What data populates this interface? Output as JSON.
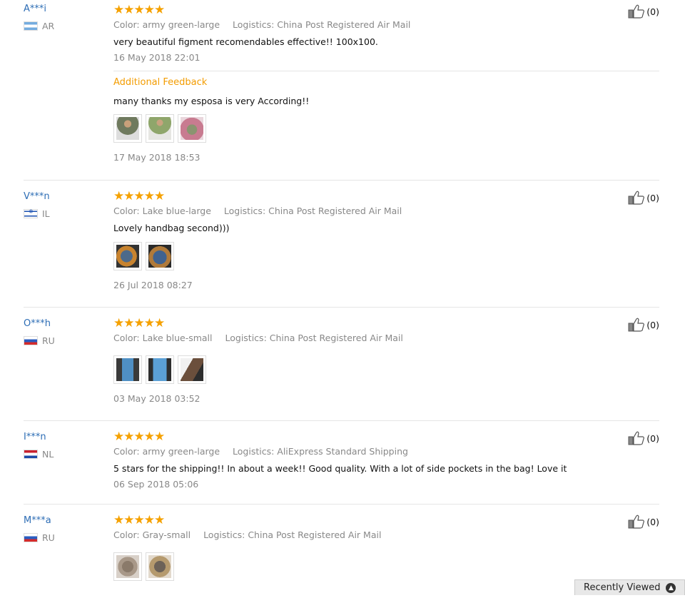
{
  "reviews": [
    {
      "user": "A***i",
      "country": "AR",
      "stars": "★★★★★",
      "color": "Color: army green-large",
      "logistics": "Logistics: China Post Registered Air Mail",
      "text": "very beautiful figment recomendables effective!! 100x100.",
      "date": "16 May 2018 22:01",
      "likes": "(0)",
      "additional": {
        "title": "Additional Feedback",
        "text": "many thanks my esposa is very According!!",
        "date": "17 May 2018 18:53"
      }
    },
    {
      "user": "V***n",
      "country": "IL",
      "stars": "★★★★★",
      "color": "Color: Lake blue-large",
      "logistics": "Logistics: China Post Registered Air Mail",
      "text": "Lovely handbag second)))",
      "date": "26 Jul 2018 08:27",
      "likes": "(0)"
    },
    {
      "user": "O***h",
      "country": "RU",
      "stars": "★★★★★",
      "color": "Color: Lake blue-small",
      "logistics": "Logistics: China Post Registered Air Mail",
      "date": "03 May 2018 03:52",
      "likes": "(0)"
    },
    {
      "user": "I***n",
      "country": "NL",
      "stars": "★★★★★",
      "color": "Color: army green-large",
      "logistics": "Logistics: AliExpress Standard Shipping",
      "text": "5 stars for the shipping!! In about a week!! Good quality. With a lot of side pockets in the bag! Love it",
      "date": "06 Sep 2018 05:06",
      "likes": "(0)"
    },
    {
      "user": "M***a",
      "country": "RU",
      "stars": "★★★★★",
      "color": "Color: Gray-small",
      "logistics": "Logistics: China Post Registered Air Mail",
      "likes": "(0)"
    }
  ],
  "recently_viewed": "Recently Viewed",
  "colors": {
    "link": "#2d6db5",
    "star": "#f5a100",
    "additional": "#f39c00"
  }
}
